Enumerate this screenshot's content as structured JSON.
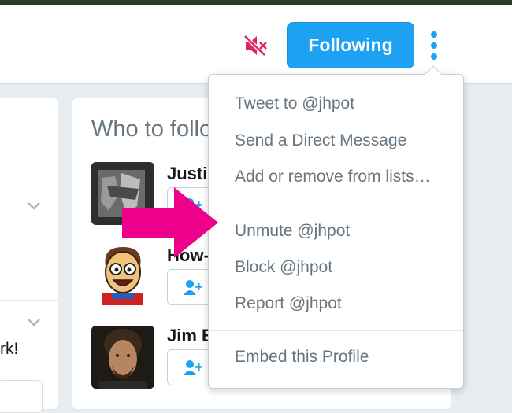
{
  "header": {
    "mute_icon": "muted-speaker-icon",
    "following_label": "Following",
    "more_icon": "vertical-dots-icon",
    "accent_color": "#1da1f2",
    "mute_color": "#e0245e"
  },
  "left_panel": {
    "partial_text": "rk!"
  },
  "who_to_follow": {
    "title": "Who to follo",
    "users": [
      {
        "name": "Justi"
      },
      {
        "name": "How-"
      },
      {
        "name": "Jim E"
      }
    ]
  },
  "menu": {
    "items": [
      "Tweet to @jhpot",
      "Send a Direct Message",
      "Add or remove from lists…",
      "Unmute @jhpot",
      "Block @jhpot",
      "Report @jhpot",
      "Embed this Profile"
    ]
  },
  "annotation": {
    "arrow_color": "#ec008c"
  }
}
